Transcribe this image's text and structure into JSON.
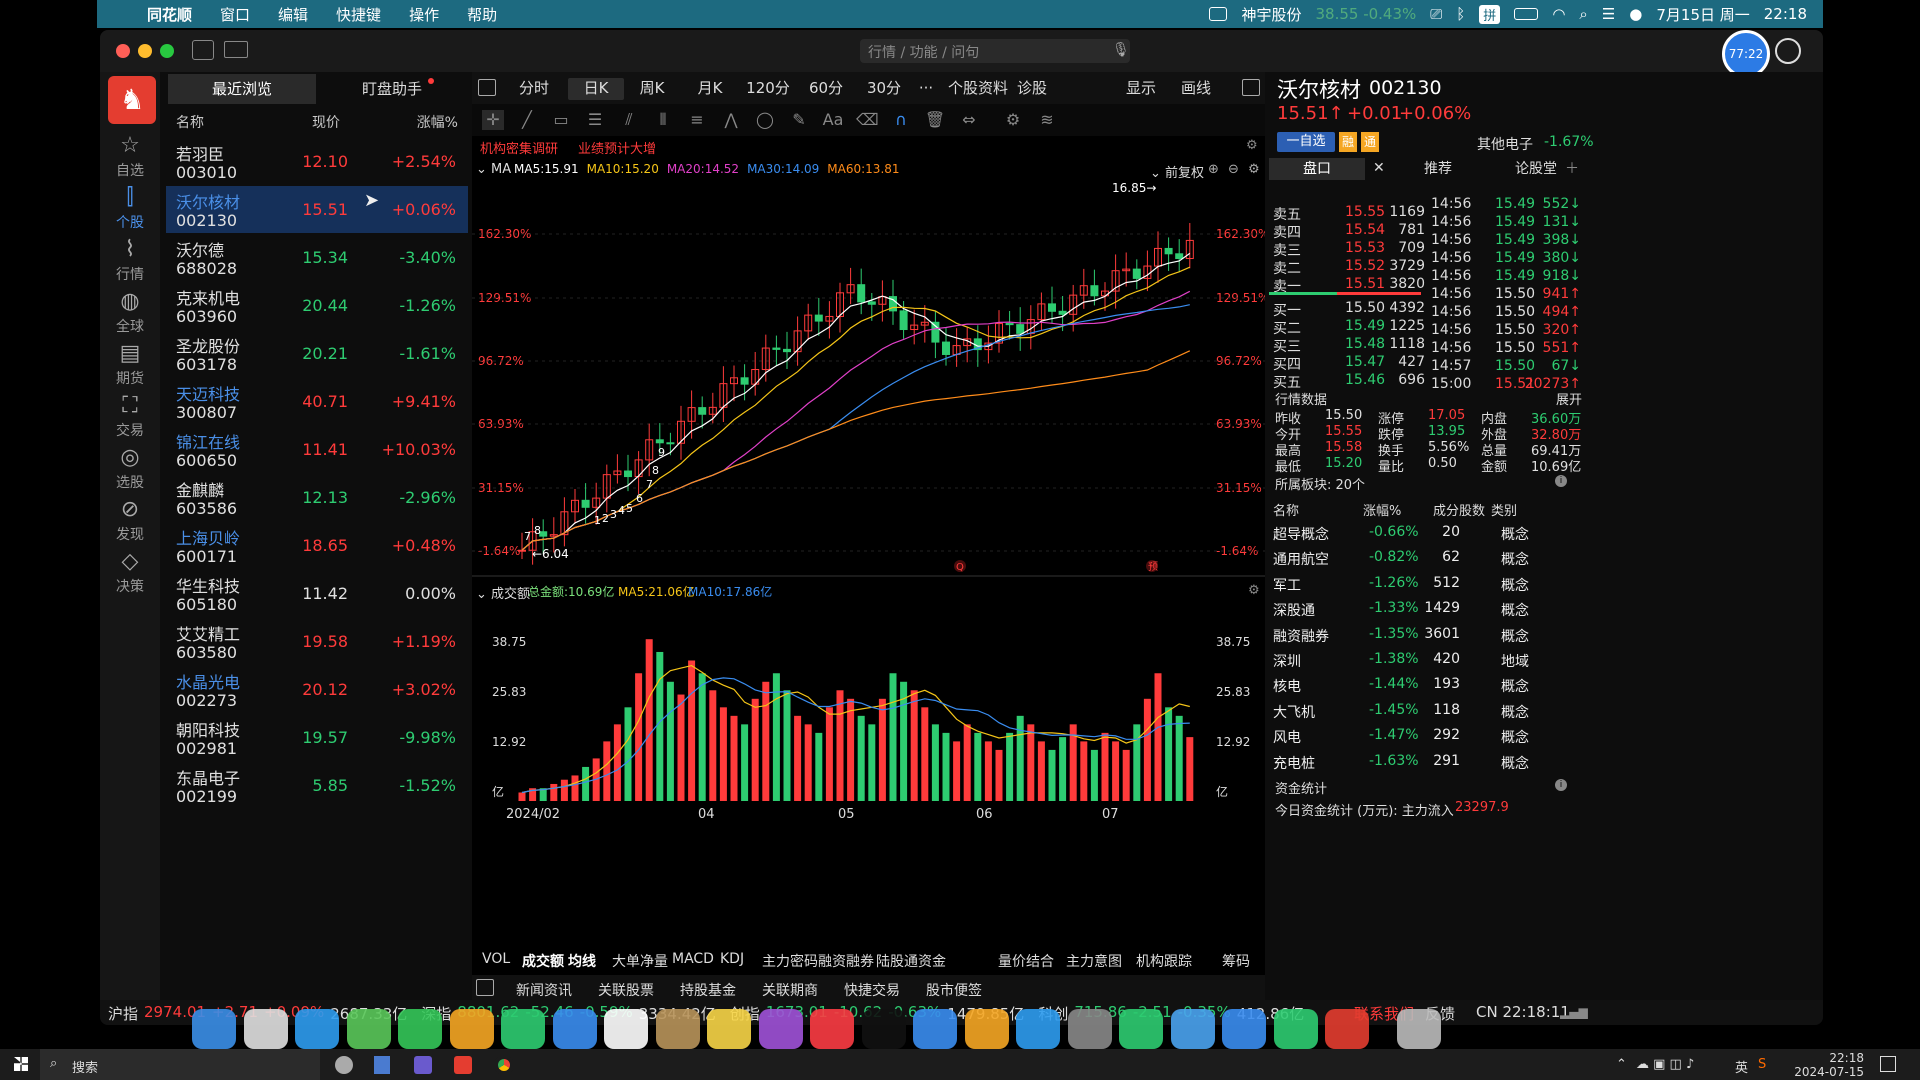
{
  "menubar": {
    "app": "同花顺",
    "items": [
      "窗口",
      "编辑",
      "快捷键",
      "操作",
      "帮助"
    ],
    "ticker_name": "神宇股份",
    "ticker_value": "38.55 -0.43%",
    "input_method": "拼",
    "date": "7月15日 周一",
    "time": "22:18"
  },
  "titlebar": {
    "search_placeholder": "行情 / 功能 / 问句",
    "badge": "77:22"
  },
  "leftnav": [
    {
      "label": "自选",
      "icon": "star-icon"
    },
    {
      "label": "个股",
      "icon": "candlestick-icon",
      "active": true
    },
    {
      "label": "行情",
      "icon": "chart-icon"
    },
    {
      "label": "全球",
      "icon": "globe-icon"
    },
    {
      "label": "期货",
      "icon": "futures-icon"
    },
    {
      "label": "交易",
      "icon": "trade-icon"
    },
    {
      "label": "选股",
      "icon": "picker-icon"
    },
    {
      "label": "发现",
      "icon": "compass-icon"
    },
    {
      "label": "决策",
      "icon": "decision-icon"
    }
  ],
  "watchlist": {
    "tabs": [
      "最近浏览",
      "盯盘助手"
    ],
    "headers": [
      "名称",
      "现价",
      "涨幅%"
    ],
    "rows": [
      {
        "name": "若羽臣",
        "code": "003010",
        "price": "12.10",
        "pct": "+2.54%",
        "dir": "up",
        "blue": false
      },
      {
        "name": "沃尔核材",
        "code": "002130",
        "price": "15.51",
        "pct": "+0.06%",
        "dir": "up",
        "blue": true,
        "selected": true
      },
      {
        "name": "沃尔德",
        "code": "688028",
        "price": "15.34",
        "pct": "-3.40%",
        "dir": "dn",
        "blue": false
      },
      {
        "name": "克来机电",
        "code": "603960",
        "price": "20.44",
        "pct": "-1.26%",
        "dir": "dn",
        "blue": false
      },
      {
        "name": "圣龙股份",
        "code": "603178",
        "price": "20.21",
        "pct": "-1.61%",
        "dir": "dn",
        "blue": false
      },
      {
        "name": "天迈科技",
        "code": "300807",
        "price": "40.71",
        "pct": "+9.41%",
        "dir": "up",
        "blue": true
      },
      {
        "name": "锦江在线",
        "code": "600650",
        "price": "11.41",
        "pct": "+10.03%",
        "dir": "up",
        "blue": true
      },
      {
        "name": "金麒麟",
        "code": "603586",
        "price": "12.13",
        "pct": "-2.96%",
        "dir": "dn",
        "blue": false
      },
      {
        "name": "上海贝岭",
        "code": "600171",
        "price": "18.65",
        "pct": "+0.48%",
        "dir": "up",
        "blue": true
      },
      {
        "name": "华生科技",
        "code": "605180",
        "price": "11.42",
        "pct": "0.00%",
        "dir": "flat",
        "blue": false
      },
      {
        "name": "艾艾精工",
        "code": "603580",
        "price": "19.58",
        "pct": "+1.19%",
        "dir": "up",
        "blue": false
      },
      {
        "name": "水晶光电",
        "code": "002273",
        "price": "20.12",
        "pct": "+3.02%",
        "dir": "up",
        "blue": true
      },
      {
        "name": "朝阳科技",
        "code": "002981",
        "price": "19.57",
        "pct": "-9.98%",
        "dir": "dn",
        "blue": false
      },
      {
        "name": "东晶电子",
        "code": "002199",
        "price": "5.85",
        "pct": "-1.52%",
        "dir": "dn",
        "blue": false
      }
    ]
  },
  "chart_tabs": [
    "分时",
    "日K",
    "周K",
    "月K",
    "120分",
    "60分",
    "30分",
    "···",
    "个股资料",
    "诊股",
    "显示",
    "画线"
  ],
  "chart": {
    "tags": [
      "机构密集调研",
      "业绩预计大增"
    ],
    "ma_label": "MA",
    "ma": [
      {
        "text": "MA5:15.91",
        "color": "#ffffff"
      },
      {
        "text": "MA10:15.20",
        "color": "#f5c518"
      },
      {
        "text": "MA20:14.52",
        "color": "#e040c8"
      },
      {
        "text": "MA30:14.09",
        "color": "#3a8df0"
      },
      {
        "text": "MA60:13.81",
        "color": "#ff8c1a"
      }
    ],
    "fuquan": "前复权",
    "left_axis": [
      "162.30%",
      "129.51%",
      "96.72%",
      "63.93%",
      "31.15%",
      "-1.64%"
    ],
    "right_axis": [
      "162.30%",
      "129.51%",
      "96.72%",
      "63.93%",
      "31.15%",
      "-1.64%"
    ],
    "high_label": "16.85",
    "low_label": "6.04",
    "seq_labels": [
      "7",
      "8",
      "1",
      "2",
      "3",
      "4",
      "5",
      "6",
      "7",
      "8",
      "9"
    ],
    "markers": [
      "Q",
      "预"
    ],
    "vol_title": "成交额",
    "vol_total": "总金额:10.69亿",
    "vol_ma5": "MA5:21.06亿",
    "vol_ma10": "MA10:17.86亿",
    "vol_axis": [
      "38.75",
      "25.83",
      "12.92",
      "亿"
    ],
    "dates": [
      "2024/02",
      "04",
      "05",
      "06",
      "07"
    ]
  },
  "chart_data": {
    "type": "bar",
    "x": [
      "2024/02",
      "04",
      "05",
      "06",
      "07"
    ],
    "series": [
      {
        "name": "成交额",
        "values": [
          2,
          3,
          3,
          4,
          5,
          6,
          8,
          10,
          14,
          18,
          22,
          30,
          38,
          35,
          28,
          25,
          33,
          30,
          26,
          22,
          20,
          18,
          24,
          28,
          30,
          26,
          20,
          18,
          16,
          22,
          26,
          24,
          20,
          18,
          24,
          30,
          28,
          26,
          22,
          18,
          16,
          14,
          18,
          16,
          14,
          12,
          16,
          20,
          18,
          14,
          12,
          15,
          18,
          14,
          12,
          16,
          14,
          12,
          18,
          24,
          30,
          22,
          20,
          15
        ]
      }
    ],
    "ylim": [
      0,
      38.75
    ]
  },
  "indicator_tabs": [
    "VOL",
    "成交额",
    "均线",
    "大单净量",
    "MACD",
    "KDJ",
    "主力密码",
    "融资融券",
    "陆股通资金",
    "量价结合",
    "主力意图",
    "机构跟踪",
    "筹码"
  ],
  "news_tabs": [
    "新闻资讯",
    "关联股票",
    "持股基金",
    "关联期商",
    "快捷交易",
    "股市便签"
  ],
  "stock": {
    "name": "沃尔核材",
    "code": "002130",
    "price": "15.51↑",
    "change": "+0.01",
    "pct": "+0.06%",
    "tag1": "一自选",
    "tag2": "融",
    "tag3": "通",
    "sector": "其他电子",
    "sector_pct": "-1.67%"
  },
  "rp_tabs": [
    "盘口",
    "推荐",
    "论股堂"
  ],
  "orderbook": {
    "asks": [
      {
        "label": "卖五",
        "price": "15.55",
        "vol": "1169"
      },
      {
        "label": "卖四",
        "price": "15.54",
        "vol": "781"
      },
      {
        "label": "卖三",
        "price": "15.53",
        "vol": "709"
      },
      {
        "label": "卖二",
        "price": "15.52",
        "vol": "3729"
      },
      {
        "label": "卖一",
        "price": "15.51",
        "vol": "3820"
      }
    ],
    "bids": [
      {
        "label": "买一",
        "price": "15.50",
        "vol": "4392"
      },
      {
        "label": "买二",
        "price": "15.49",
        "vol": "1225"
      },
      {
        "label": "买三",
        "price": "15.48",
        "vol": "1118"
      },
      {
        "label": "买四",
        "price": "15.47",
        "vol": "427"
      },
      {
        "label": "买五",
        "price": "15.46",
        "vol": "696"
      }
    ]
  },
  "ticks": [
    {
      "t": "14:56",
      "p": "15.49",
      "v": "552↓",
      "d": "dn"
    },
    {
      "t": "14:56",
      "p": "15.49",
      "v": "131↓",
      "d": "dn"
    },
    {
      "t": "14:56",
      "p": "15.49",
      "v": "398↓",
      "d": "dn"
    },
    {
      "t": "14:56",
      "p": "15.49",
      "v": "380↓",
      "d": "dn"
    },
    {
      "t": "14:56",
      "p": "15.49",
      "v": "918↓",
      "d": "dn"
    },
    {
      "t": "14:56",
      "p": "15.50",
      "v": "941↑",
      "d": "up"
    },
    {
      "t": "14:56",
      "p": "15.50",
      "v": "494↑",
      "d": "up"
    },
    {
      "t": "14:56",
      "p": "15.50",
      "v": "320↑",
      "d": "up"
    },
    {
      "t": "14:56",
      "p": "15.50",
      "v": "551↑",
      "d": "up"
    },
    {
      "t": "14:57",
      "p": "15.50",
      "v": "67↓",
      "d": "dn"
    },
    {
      "t": "15:00",
      "p": "15.51",
      "v": "20273↑",
      "d": "up"
    }
  ],
  "quote": {
    "title": "行情数据",
    "expand": "展开",
    "rows": [
      [
        {
          "k": "昨收",
          "v": "15.50",
          "c": "flat"
        },
        {
          "k": "涨停",
          "v": "17.05",
          "c": "up"
        },
        {
          "k": "内盘",
          "v": "36.60万",
          "c": "dn"
        }
      ],
      [
        {
          "k": "今开",
          "v": "15.55",
          "c": "up"
        },
        {
          "k": "跌停",
          "v": "13.95",
          "c": "dn"
        },
        {
          "k": "外盘",
          "v": "32.80万",
          "c": "up"
        }
      ],
      [
        {
          "k": "最高",
          "v": "15.58",
          "c": "up"
        },
        {
          "k": "换手",
          "v": "5.56%",
          "c": "flat"
        },
        {
          "k": "总量",
          "v": "69.41万",
          "c": "flat"
        }
      ],
      [
        {
          "k": "最低",
          "v": "15.20",
          "c": "dn"
        },
        {
          "k": "量比",
          "v": "0.50",
          "c": "flat"
        },
        {
          "k": "金额",
          "v": "10.69亿",
          "c": "flat"
        }
      ]
    ]
  },
  "sectors": {
    "title": "所属板块: 20个",
    "headers": [
      "名称",
      "涨幅%",
      "成分股数",
      "类别"
    ],
    "rows": [
      {
        "n": "超导概念",
        "p": "-0.66%",
        "c": "20",
        "t": "概念"
      },
      {
        "n": "通用航空",
        "p": "-0.82%",
        "c": "62",
        "t": "概念"
      },
      {
        "n": "军工",
        "p": "-1.26%",
        "c": "512",
        "t": "概念"
      },
      {
        "n": "深股通",
        "p": "-1.33%",
        "c": "1429",
        "t": "概念"
      },
      {
        "n": "融资融券",
        "p": "-1.35%",
        "c": "3601",
        "t": "概念"
      },
      {
        "n": "深圳",
        "p": "-1.38%",
        "c": "420",
        "t": "地域"
      },
      {
        "n": "核电",
        "p": "-1.44%",
        "c": "193",
        "t": "概念"
      },
      {
        "n": "大飞机",
        "p": "-1.45%",
        "c": "118",
        "t": "概念"
      },
      {
        "n": "风电",
        "p": "-1.47%",
        "c": "292",
        "t": "概念"
      },
      {
        "n": "充电桩",
        "p": "-1.63%",
        "c": "291",
        "t": "概念"
      }
    ]
  },
  "funds": {
    "title": "资金统计",
    "line": "今日资金统计 (万元): 主力流入",
    "value": "23297.9"
  },
  "statusbar": {
    "items": [
      {
        "name": "沪指",
        "val": "2974.01",
        "chg": "+2.71",
        "pct": "+0.09%",
        "amt": "2687.33亿",
        "dir": "up"
      },
      {
        "name": "深指",
        "val": "8801.62",
        "chg": "-52.46",
        "pct": "-0.59%",
        "amt": "3334.42亿",
        "dir": "dn"
      },
      {
        "name": "创指",
        "val": "1673.01",
        "chg": "-10.62",
        "pct": "-0.63%",
        "amt": "1479.85亿",
        "dir": "dn"
      },
      {
        "name": "科创",
        "val": "715.86",
        "chg": "-2.51",
        "pct": "-0.35%",
        "amt": "412.86亿",
        "dir": "dn"
      }
    ],
    "contact": "联系我们",
    "feedback": "反馈",
    "clock": "CN 22:18:11"
  },
  "taskbar": {
    "search": "搜索",
    "time": "22:18",
    "date": "2024-07-15",
    "lang": "英"
  }
}
